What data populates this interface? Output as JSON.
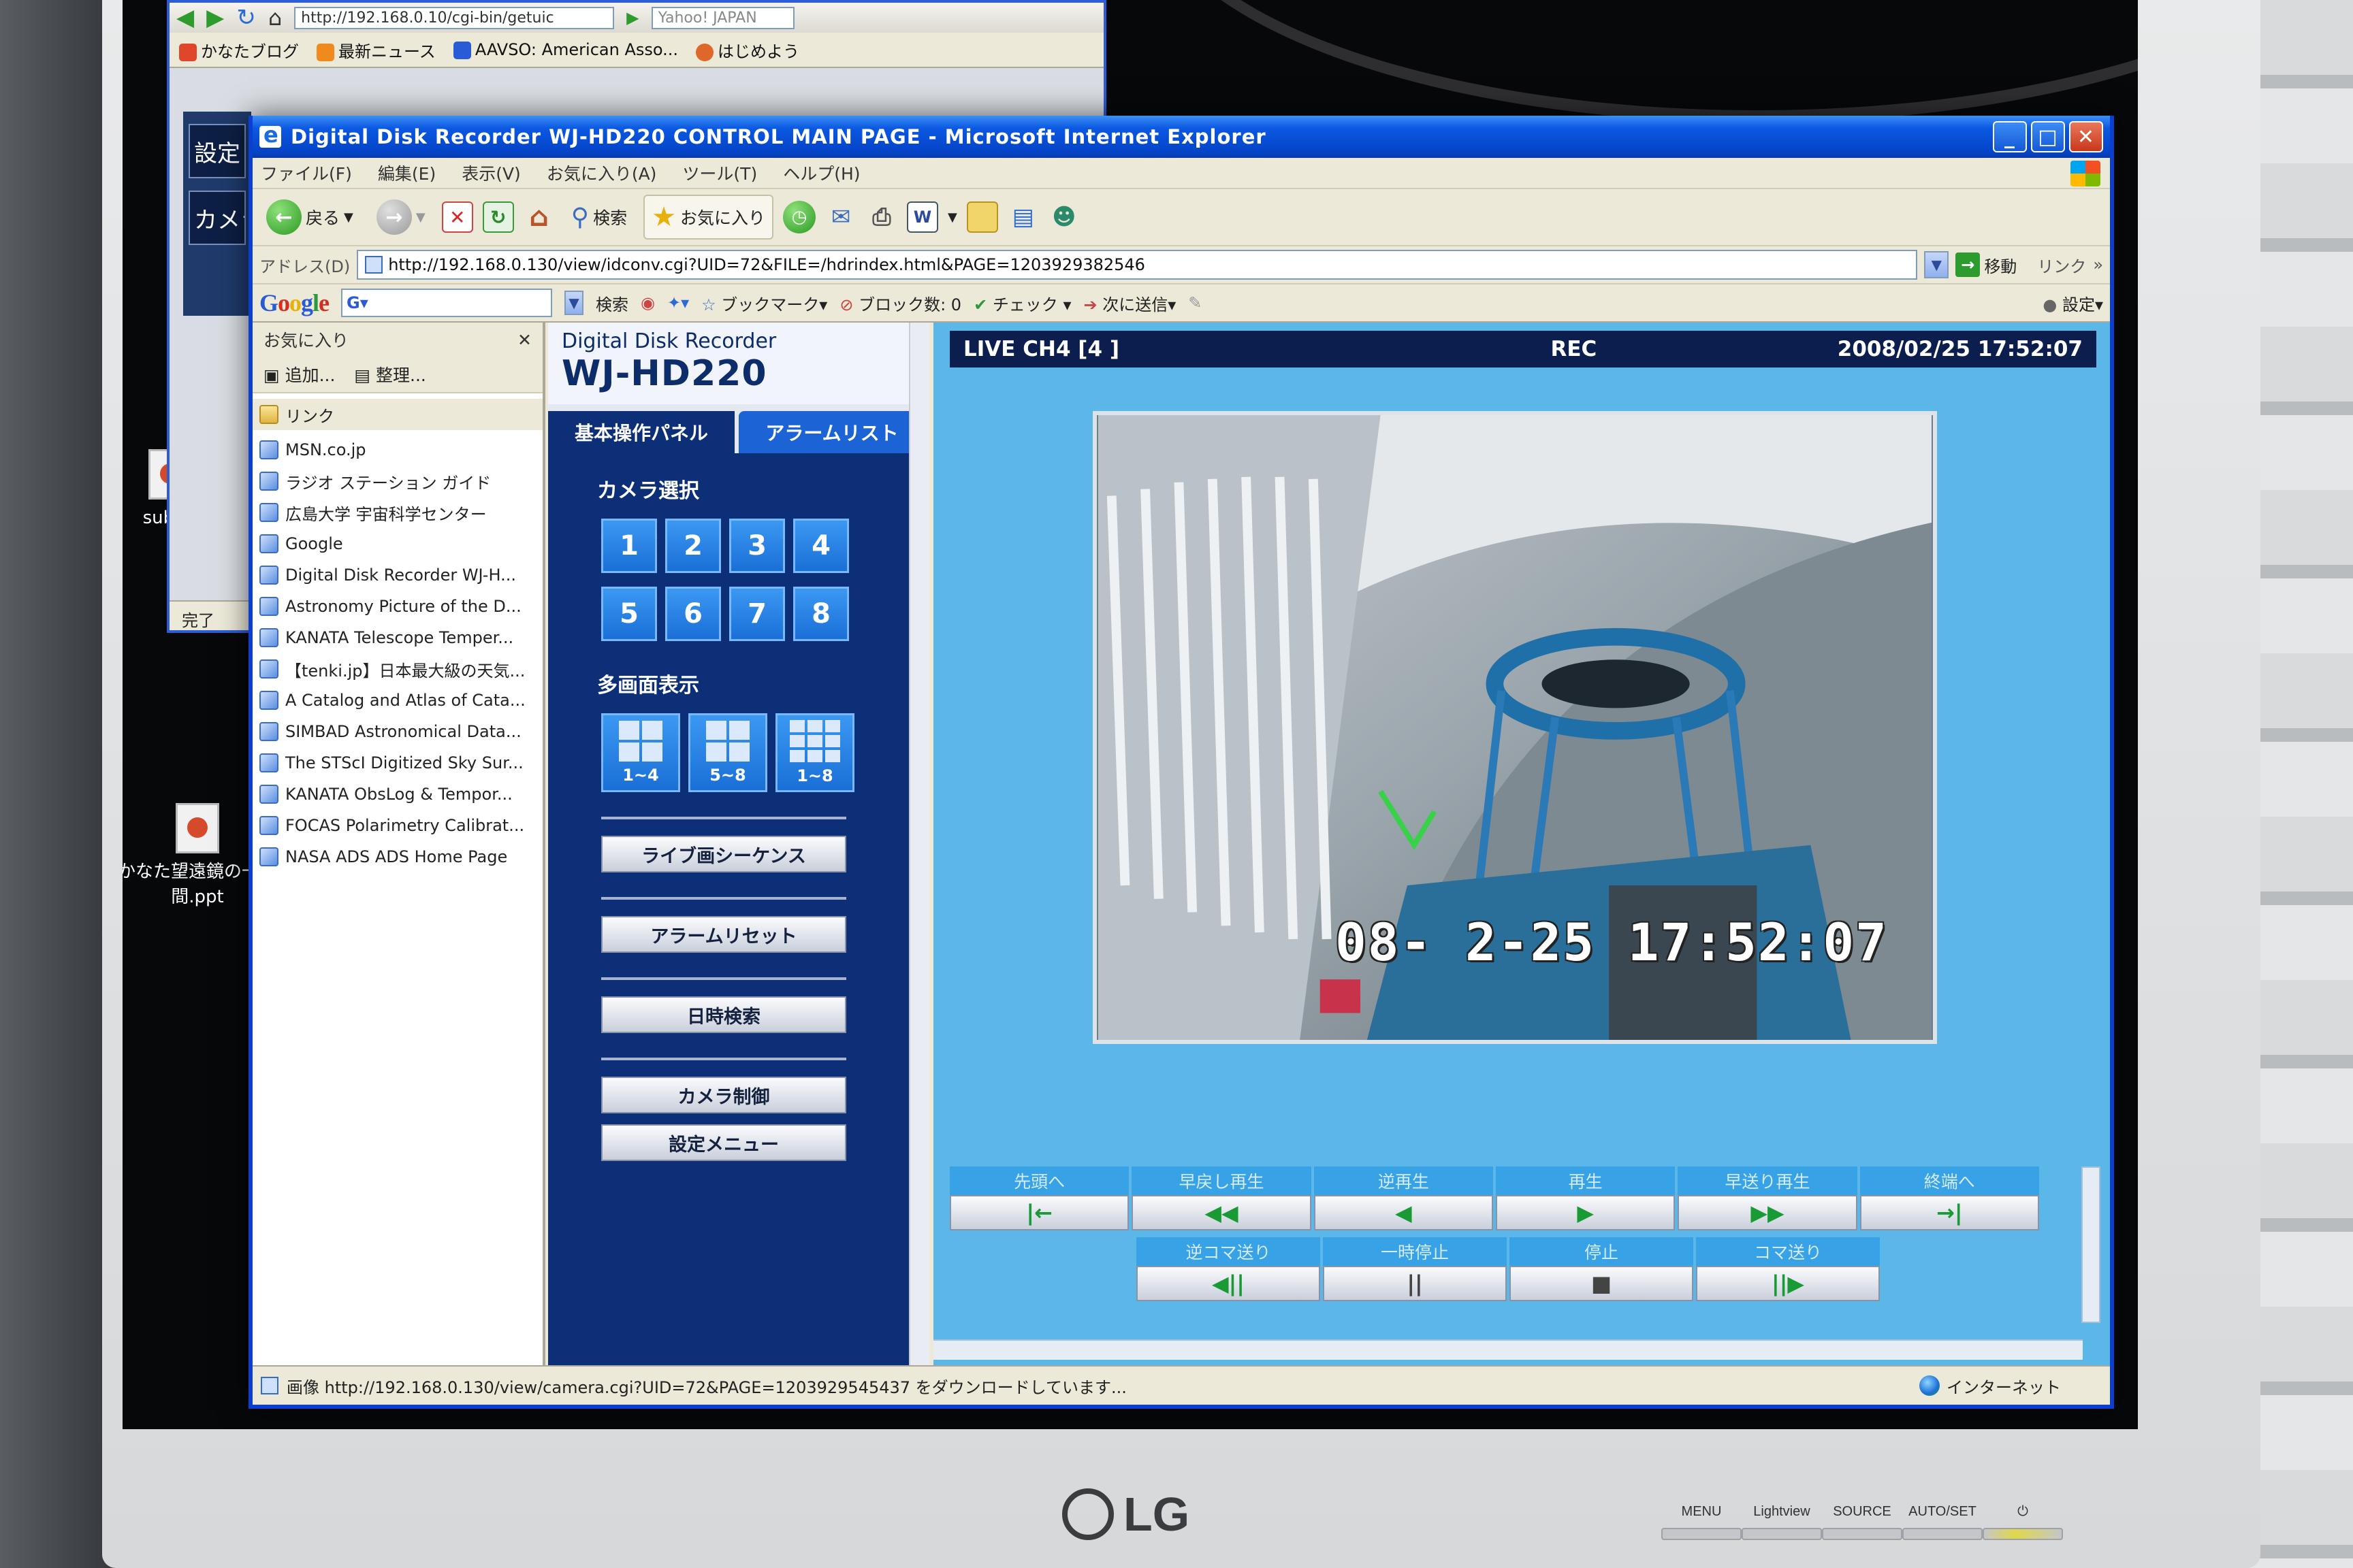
{
  "desktop": {
    "icons": [
      {
        "label": "sub へ"
      },
      {
        "label": "かなた望遠鏡の一年間.ppt"
      }
    ]
  },
  "bg_window": {
    "url": "http://192.168.0.10/cgi-bin/getuic",
    "search_text": "Yahoo! JAPAN",
    "links": [
      "かなたブログ",
      "最新ニュース",
      "AAVSO: American Asso...",
      "はじめよう"
    ],
    "side_items": [
      "設定",
      "カメラ"
    ],
    "status": "完了"
  },
  "ie": {
    "title": "Digital Disk Recorder WJ-HD220 CONTROL MAIN PAGE - Microsoft Internet Explorer",
    "menu": [
      "ファイル(F)",
      "編集(E)",
      "表示(V)",
      "お気に入り(A)",
      "ツール(T)",
      "ヘルプ(H)"
    ],
    "toolbar": {
      "back": "戻る",
      "search": "検索",
      "favorites": "お気に入り"
    },
    "address": {
      "label": "アドレス(D)",
      "value": "http://192.168.0.130/view/idconv.cgi?UID=72&FILE=/hdrindex.html&PAGE=1203929382546",
      "go": "移動",
      "links": "リンク"
    },
    "googlebar": {
      "logo": "Google",
      "input": "G▾",
      "search": "検索",
      "bookmarks": "ブックマーク▾",
      "blocked": "ブロック数: 0",
      "check": "チェック",
      "send": "次に送信▾",
      "settings": "設定▾"
    },
    "status": {
      "text": "画像 http://192.168.0.130/view/camera.cgi?UID=72&PAGE=1203929545437 をダウンロードしています...",
      "zone": "インターネット"
    }
  },
  "favorites": {
    "title": "お気に入り",
    "add": "追加...",
    "organize": "整理...",
    "folder": "リンク",
    "items": [
      "MSN.co.jp",
      "ラジオ ステーション ガイド",
      "広島大学 宇宙科学センター",
      "Google",
      "Digital Disk Recorder WJ-H...",
      "Astronomy Picture of the D...",
      "KANATA Telescope Temper...",
      "【tenki.jp】日本最大級の天気...",
      "A Catalog and Atlas of Cata...",
      "SIMBAD Astronomical Data...",
      "The STScI Digitized Sky Sur...",
      "KANATA ObsLog & Tempor...",
      "FOCAS Polarimetry Calibrat...",
      "NASA ADS ADS Home Page"
    ]
  },
  "recorder": {
    "brand_small": "Digital Disk Recorder",
    "brand_model": "WJ-HD220",
    "tabs": [
      "基本操作パネル",
      "アラームリスト"
    ],
    "camera_select_title": "カメラ選択",
    "cameras": [
      "1",
      "2",
      "3",
      "4",
      "5",
      "6",
      "7",
      "8"
    ],
    "multi_title": "多画面表示",
    "multi": [
      "1~4",
      "5~8",
      "1~8"
    ],
    "buttons": [
      "ライブ画シーケンス",
      "アラームリセット",
      "日時検索",
      "カメラ制御",
      "設定メニュー"
    ],
    "live": {
      "channel": "LIVE CH4 [4   ]",
      "rec": "REC",
      "datetime": "2008/02/25 17:52:07"
    },
    "osd": "08- 2-25 17:52:07",
    "playback_row1": [
      {
        "label": "先頭へ",
        "icon": "|←"
      },
      {
        "label": "早戻し再生",
        "icon": "◀◀"
      },
      {
        "label": "逆再生",
        "icon": "◀"
      },
      {
        "label": "再生",
        "icon": "▶"
      },
      {
        "label": "早送り再生",
        "icon": "▶▶"
      },
      {
        "label": "終端へ",
        "icon": "→|"
      }
    ],
    "playback_row2": [
      {
        "label": "逆コマ送り",
        "icon": "◀||"
      },
      {
        "label": "一時停止",
        "icon": "||"
      },
      {
        "label": "停止",
        "icon": "■"
      },
      {
        "label": "コマ送り",
        "icon": "||▶"
      }
    ]
  },
  "monitor": {
    "brand": "LG",
    "buttons": [
      "MENU",
      "Lightview",
      "SOURCE",
      "AUTO/SET",
      "⏻"
    ]
  }
}
